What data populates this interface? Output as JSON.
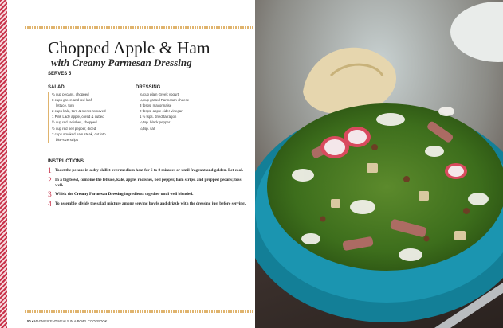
{
  "recipe": {
    "title": "Chopped Apple & Ham",
    "subtitle": "with Creamy Parmesan Dressing",
    "serves": "SERVES 5"
  },
  "salad": {
    "heading": "SALAD",
    "items": [
      "¼ cup pecans, chopped",
      "8 cups green and red leaf",
      "lettuce, torn",
      "2 cups kale, torn & stems removed",
      "1 Pink Lady apple, cored & cubed",
      "½ cup red radishes, chopped",
      "½ cup red bell pepper, diced",
      "2 cups smoked ham steak, cut into",
      "bite-size strips"
    ]
  },
  "dressing": {
    "heading": "DRESSING",
    "items": [
      "¾ cup plain Greek yogurt",
      "¼ cup grated Parmesan cheese",
      "3 tbsps. mayonnaise",
      "2 tbsps. apple cider vinegar",
      "1 ½ tsps. dried tarragon",
      "¼ tsp. black pepper",
      "¼ tsp. salt"
    ]
  },
  "instructions": {
    "heading": "INSTRUCTIONS",
    "steps": [
      {
        "num": "1",
        "text": "Toast the pecans in a dry skillet over medium heat for 6 to 8 minutes or until fragrant and golden. Let cool."
      },
      {
        "num": "2",
        "text": "In a big bowl, combine the lettuce, kale, apple, radishes, bell pepper, ham strips, and prepped pecans; toss well."
      },
      {
        "num": "3",
        "pre": "Whisk the ",
        "bold": "Creamy Parmesan Dressing",
        "post": " ingredients together until well blended."
      },
      {
        "num": "4",
        "text": "To assemble, divide the salad mixture among serving bowls and drizzle with the dressing just before serving."
      }
    ]
  },
  "footer": {
    "page_number": "50",
    "separator": "•",
    "book_title": "MAGNIFICENT MEALS IN A BOWL COOKBOOK"
  },
  "colors": {
    "accent_red": "#c8324a",
    "rule_gold": "#e0b46e",
    "plate_teal": "#1b95b0"
  }
}
